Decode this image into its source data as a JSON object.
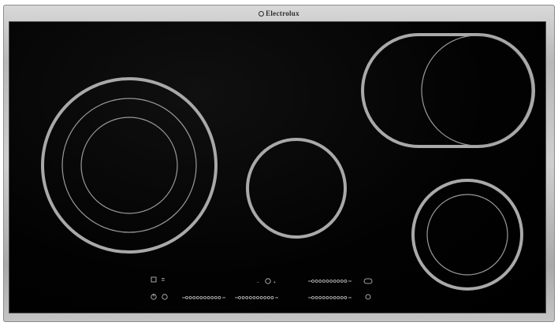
{
  "brand": {
    "name": "Electrolux"
  },
  "colors": {
    "frame": "#bdbdbd",
    "glass": "#000000",
    "zone_ring": "#a9a9a9",
    "zone_thin": "#9a9a9a",
    "controls": "#cfcfcf"
  },
  "cooking_zones": [
    {
      "id": "left-triple",
      "label": "Large triple ring zone"
    },
    {
      "id": "center-single",
      "label": "Center single zone"
    },
    {
      "id": "rear-right-oval",
      "label": "Rear right oval zone"
    },
    {
      "id": "front-right-dual",
      "label": "Front right dual zone"
    }
  ],
  "control_panel": {
    "icons": [
      "lock-icon",
      "power-icon",
      "timer-icon",
      "minus-icon",
      "plus-icon",
      "oval-zone-icon",
      "dual-zone-icon"
    ],
    "timer_minus": "−",
    "timer_plus": "+"
  }
}
